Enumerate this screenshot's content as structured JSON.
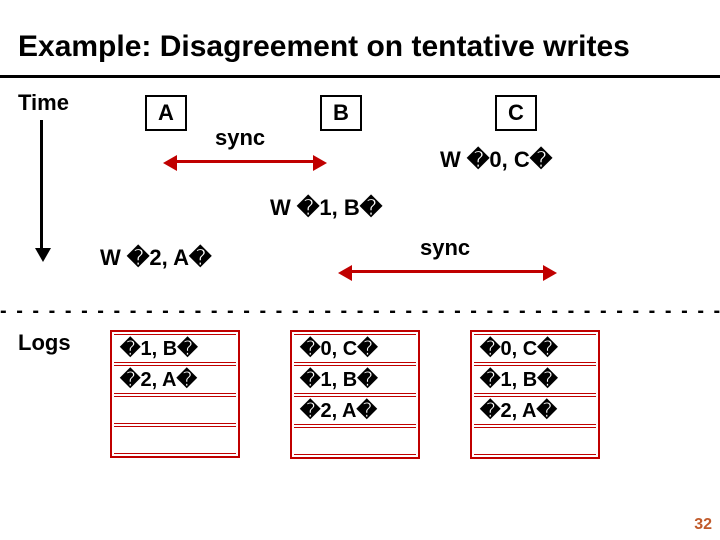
{
  "title": "Example: Disagreement on tentative writes",
  "time_label": "Time",
  "nodes": {
    "a": "A",
    "b": "B",
    "c": "C"
  },
  "sync": "sync",
  "writes": {
    "wc": "W �0, C�",
    "wb": "W �1, B�",
    "wa": "W �2, A�"
  },
  "logs_label": "Logs",
  "logs": {
    "a": [
      "�1, B�",
      "�2, A�",
      "",
      ""
    ],
    "b": [
      "�0, C�",
      "�1, B�",
      "�2, A�",
      ""
    ],
    "c": [
      "�0, C�",
      "�1, B�",
      "�2, A�",
      ""
    ]
  },
  "dashes": "- - - - - - - - - - - - - - - - - - - - - - - - - - - - - - - - - - - - - - - - - - - - - - - - - - - - -",
  "page_number": "32"
}
